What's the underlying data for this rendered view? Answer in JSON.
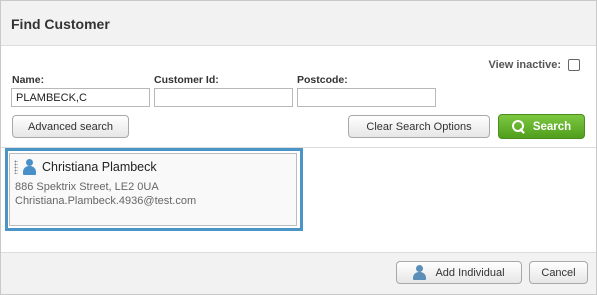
{
  "dialog": {
    "title": "Find Customer"
  },
  "filters": {
    "view_inactive_label": "View inactive:",
    "name_label": "Name:",
    "name_value": "PLAMBECK,C",
    "customer_id_label": "Customer Id:",
    "customer_id_value": "",
    "postcode_label": "Postcode:",
    "postcode_value": ""
  },
  "buttons": {
    "advanced_search": "Advanced search",
    "clear_search_options": "Clear Search Options",
    "search": "Search",
    "add_individual": "Add Individual",
    "cancel": "Cancel"
  },
  "results": [
    {
      "name": "Christiana Plambeck",
      "address": "886 Spektrix Street, LE2 0UA",
      "email": "Christiana.Plambeck.4936@test.com"
    }
  ],
  "colors": {
    "primary_green": "#5cb027",
    "selection_blue": "#4a94c6",
    "person_icon": "#4a90c8"
  },
  "icons": [
    "search-icon",
    "person-icon",
    "drag-handle-icon",
    "checkbox"
  ]
}
